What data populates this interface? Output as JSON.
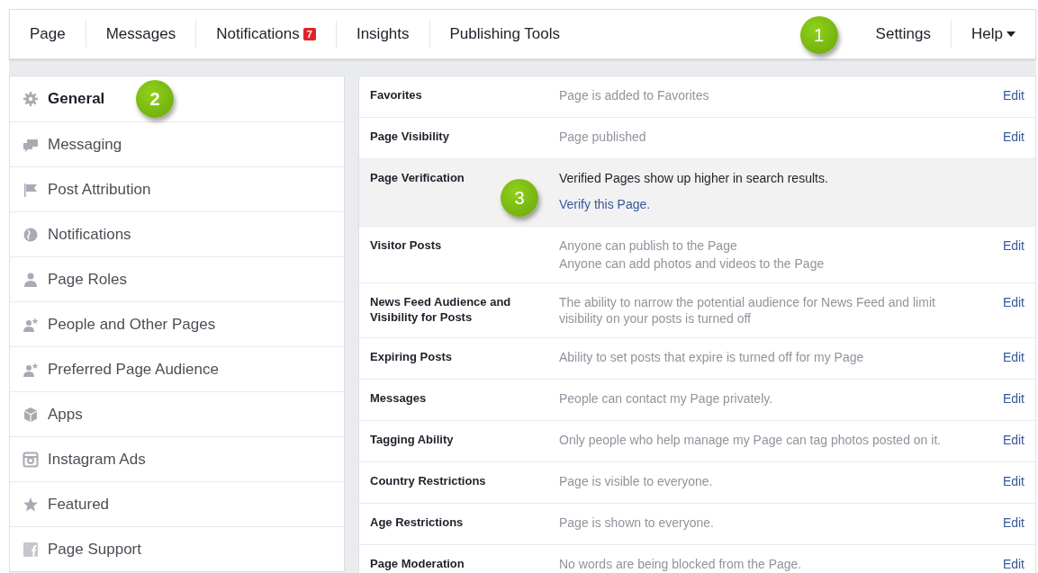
{
  "nav": {
    "left": [
      {
        "label": "Page"
      },
      {
        "label": "Messages"
      },
      {
        "label": "Notifications",
        "badge": "7"
      },
      {
        "label": "Insights"
      },
      {
        "label": "Publishing Tools"
      }
    ],
    "right": [
      {
        "label": "Settings",
        "kind": "link",
        "callout": "1"
      },
      {
        "label": "Help",
        "kind": "dropdown"
      }
    ]
  },
  "sidebar": {
    "items": [
      {
        "label": "General",
        "selected": true,
        "callout": "2"
      },
      {
        "label": "Messaging",
        "selected": false
      },
      {
        "label": "Post Attribution",
        "selected": false
      },
      {
        "label": "Notifications",
        "selected": false
      },
      {
        "label": "Page Roles",
        "selected": false
      },
      {
        "label": "People and Other Pages",
        "selected": false
      },
      {
        "label": "Preferred Page Audience",
        "selected": false
      },
      {
        "label": "Apps",
        "selected": false
      },
      {
        "label": "Instagram Ads",
        "selected": false
      },
      {
        "label": "Featured",
        "selected": false
      },
      {
        "label": "Page Support",
        "selected": false
      }
    ]
  },
  "settings": [
    {
      "name": "Favorites",
      "lines": [
        "Page is added to Favorites"
      ],
      "edit": "Edit",
      "highlighted": false
    },
    {
      "name": "Page Visibility",
      "lines": [
        "Page published"
      ],
      "edit": "Edit",
      "highlighted": false
    },
    {
      "name": "Page Verification",
      "lines": [
        "Verified Pages show up higher in search results."
      ],
      "link": "Verify this Page.",
      "highlighted": true,
      "callout": "3"
    },
    {
      "name": "Visitor Posts",
      "lines": [
        "Anyone can publish to the Page",
        "Anyone can add photos and videos to the Page"
      ],
      "edit": "Edit",
      "highlighted": false
    },
    {
      "name": "News Feed Audience and Visibility for Posts",
      "lines": [
        "The ability to narrow the potential audience for News Feed and limit visibility on your posts is turned off"
      ],
      "edit": "Edit",
      "highlighted": false
    },
    {
      "name": "Expiring Posts",
      "lines": [
        "Ability to set posts that expire is turned off for my Page"
      ],
      "edit": "Edit",
      "highlighted": false
    },
    {
      "name": "Messages",
      "lines": [
        "People can contact my Page privately."
      ],
      "edit": "Edit",
      "highlighted": false
    },
    {
      "name": "Tagging Ability",
      "lines": [
        "Only people who help manage my Page can tag photos posted on it."
      ],
      "edit": "Edit",
      "highlighted": false
    },
    {
      "name": "Country Restrictions",
      "lines": [
        "Page is visible to everyone."
      ],
      "edit": "Edit",
      "highlighted": false
    },
    {
      "name": "Age Restrictions",
      "lines": [
        "Page is shown to everyone."
      ],
      "edit": "Edit",
      "highlighted": false
    },
    {
      "name": "Page Moderation",
      "lines": [
        "No words are being blocked from the Page."
      ],
      "edit": "Edit",
      "highlighted": false
    }
  ]
}
